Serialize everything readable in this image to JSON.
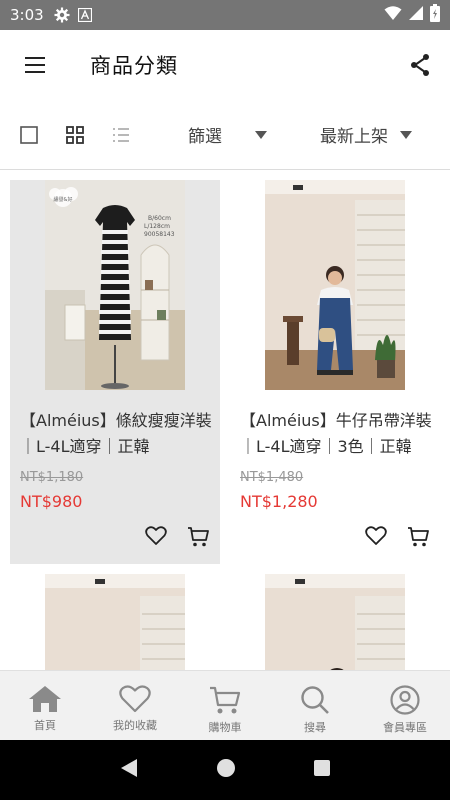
{
  "status_bar": {
    "time": "3:03"
  },
  "app_bar": {
    "title": "商品分類"
  },
  "toolbar": {
    "filter_label": "篩選",
    "sort_label": "最新上架"
  },
  "products": [
    {
      "name": "【Alméius】條紋瘦瘦洋裝｜L-4L適穿｜正韓",
      "original_price": "NT$1,180",
      "price": "NT$980",
      "photo_text": "B/60cm L/128cm 90058143",
      "photo_logo": "繡發&好"
    },
    {
      "name": "【Alméius】牛仔吊帶洋裝｜L-4L適穿｜3色｜正韓",
      "original_price": "NT$1,480",
      "price": "NT$1,280"
    }
  ],
  "bottom_nav": {
    "items": [
      {
        "label": "首頁",
        "icon": "home-icon"
      },
      {
        "label": "我的收藏",
        "icon": "heart-icon"
      },
      {
        "label": "購物車",
        "icon": "cart-icon"
      },
      {
        "label": "搜尋",
        "icon": "search-icon"
      },
      {
        "label": "會員專區",
        "icon": "account-icon"
      }
    ]
  },
  "colors": {
    "status_bar": "#757575",
    "price": "#e53935",
    "nav_bg": "#f1f1f1",
    "selected_card": "#e7e7e7"
  }
}
